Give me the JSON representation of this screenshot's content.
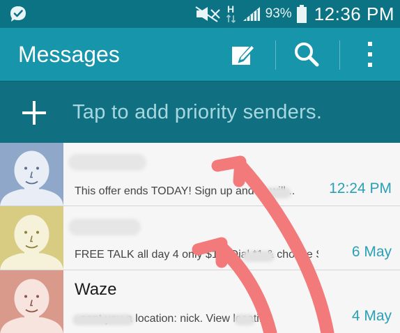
{
  "status_bar": {
    "battery": "93%",
    "clock": "12:36 PM",
    "network_label": "H",
    "icons": [
      "app-notification-icon",
      "mute-icon",
      "signal-icon",
      "battery-icon"
    ]
  },
  "action_bar": {
    "title": "Messages",
    "actions": [
      "compose-icon",
      "search-icon",
      "overflow-menu-icon"
    ]
  },
  "priority_bar": {
    "text": "Tap to add priority senders.",
    "icon": "plus-icon"
  },
  "messages": [
    {
      "sender": "",
      "snippet": "This offer ends TODAY! Sign up and br      will...",
      "time": "12:24 PM",
      "avatar_color": "#8fa8c9"
    },
    {
      "sender": "",
      "snippet": "FREE TALK all day 4 only $10! Dial *1       & choose S...",
      "time": "6 May",
      "avatar_color": "#d8cc83"
    },
    {
      "sender": "Waze",
      "snippet": "           . sent you a location:      nick. View locati...",
      "time": "4 May",
      "avatar_color": "#d9998b"
    }
  ],
  "colors": {
    "status_bar": "#0c7384",
    "action_bar": "#1795aa",
    "priority_bar": "#107082",
    "time_text": "#2aa0b5",
    "annotation_arrow": "#f27a7a"
  }
}
